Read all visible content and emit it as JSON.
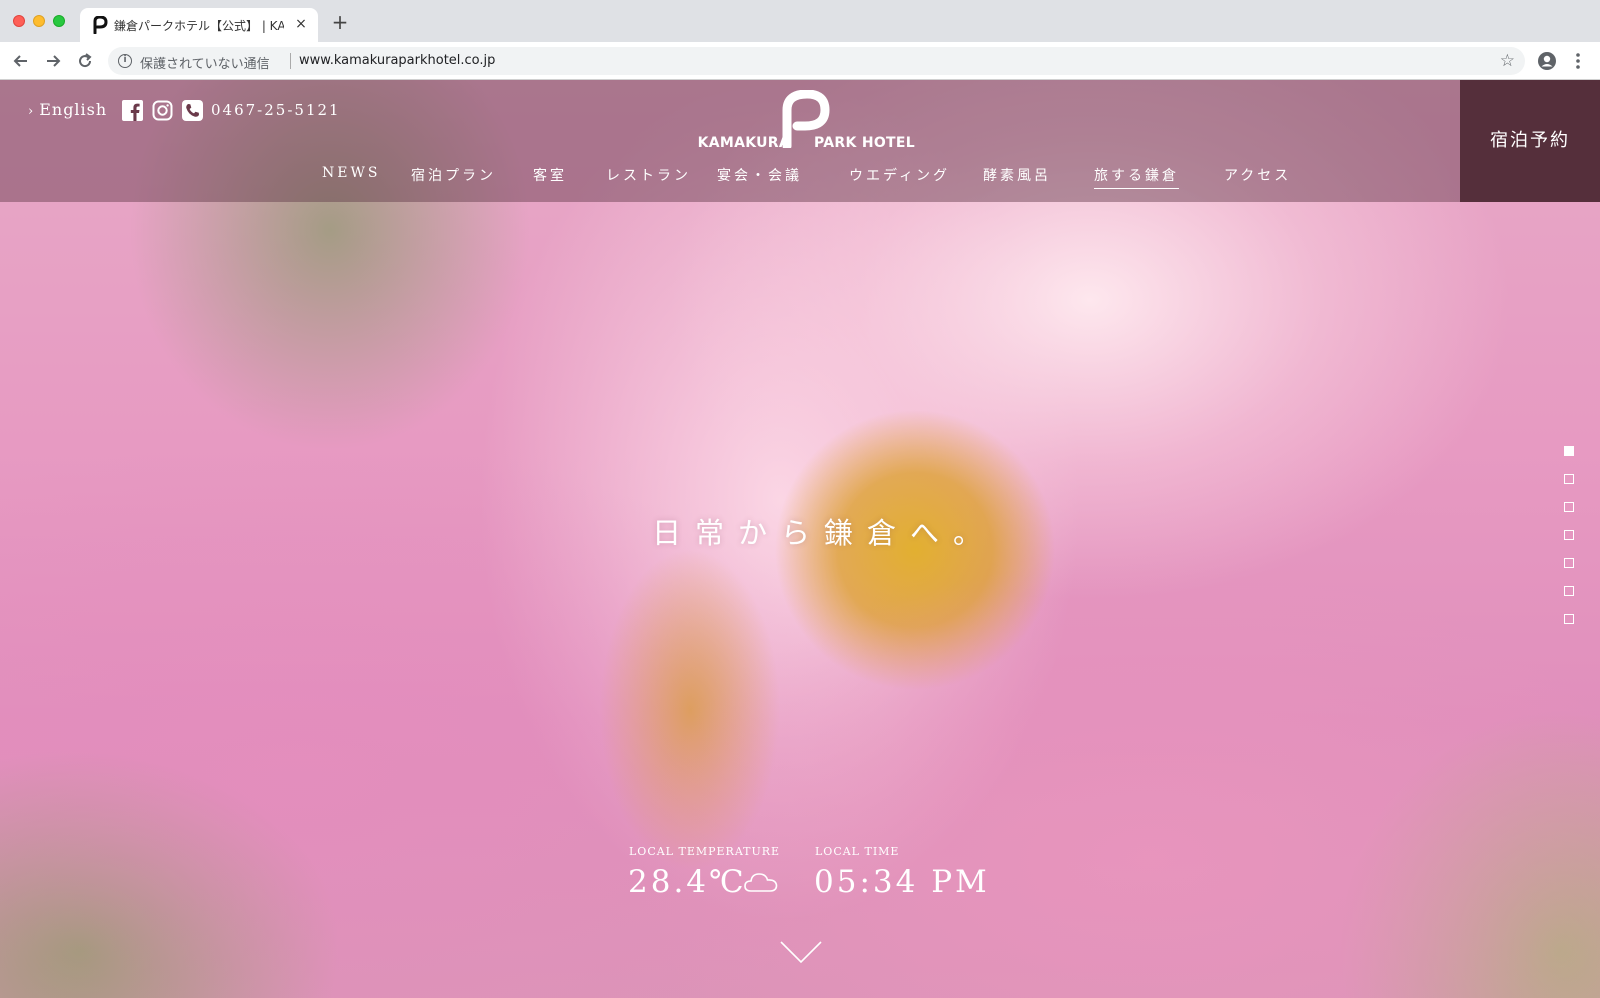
{
  "browser": {
    "tab_title": "鎌倉パークホテル【公式】 | KAMAKURA PARK HOTEL",
    "tab_close": "×",
    "new_tab": "+",
    "security_text": "保護されていない通信",
    "url": "www.kamakuraparkhotel.co.jp",
    "back_icon": "arrow-left-icon",
    "forward_icon": "arrow-right-icon",
    "reload_icon": "reload-icon"
  },
  "header": {
    "language_link": "English",
    "phone": "0467-25-5121",
    "logo_left": "KAMAKURA",
    "logo_right": "PARK HOTEL",
    "book_button": "宿泊予約",
    "nav": [
      {
        "label": "NEWS"
      },
      {
        "label": "宿泊プラン"
      },
      {
        "label": "客室"
      },
      {
        "label": "レストラン"
      },
      {
        "label": "宴会・会議"
      },
      {
        "label": "ウエディング"
      },
      {
        "label": "酵素風呂"
      },
      {
        "label": "旅する鎌倉",
        "active": true
      },
      {
        "label": "アクセス"
      }
    ]
  },
  "hero": {
    "catchphrase": "日常から鎌倉へ。",
    "slide_count": 7,
    "active_slide": 1
  },
  "weather": {
    "temperature_label": "LOCAL TEMPERATURE",
    "temperature": "28.4℃",
    "condition_icon": "cloud-icon",
    "time_label": "LOCAL TIME",
    "time": "05:34 PM"
  },
  "colors": {
    "header_overlay": "#5f3746",
    "book_button_bg": "#46232d",
    "hero_pink": "#e79ac2"
  }
}
